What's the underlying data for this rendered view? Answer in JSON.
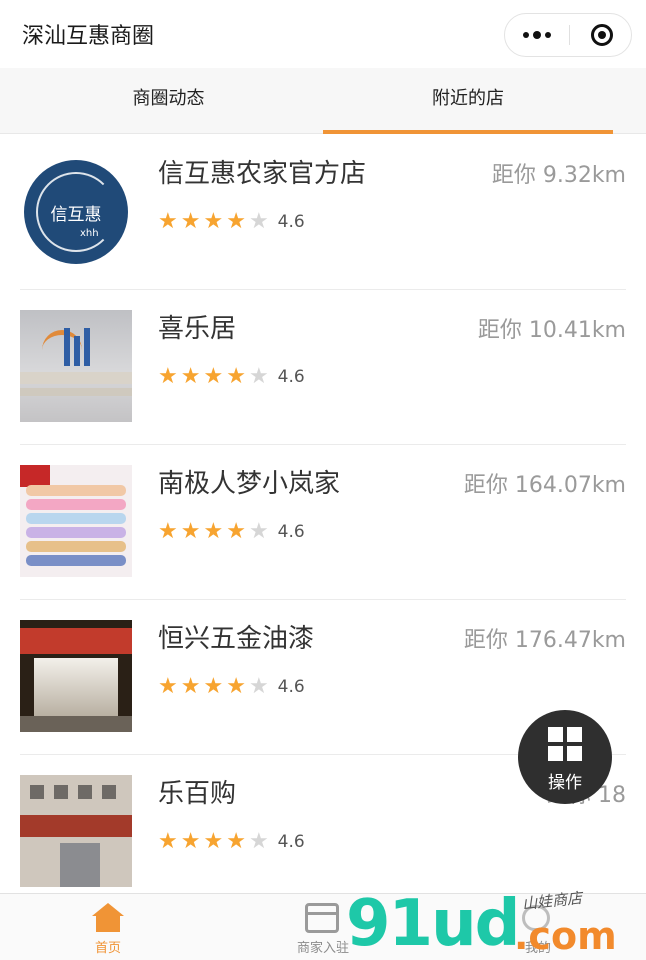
{
  "app": {
    "title": "深汕互惠商圈"
  },
  "tabs": [
    {
      "label": "商圈动态",
      "active": false
    },
    {
      "label": "附近的店",
      "active": true
    }
  ],
  "accent_color": "#f09436",
  "stores": [
    {
      "name": "信互惠农家官方店",
      "distance": "距你 9.32km",
      "stars": 4,
      "rating": "4.6",
      "logo_text": "信互惠",
      "logo_sub": "xhh"
    },
    {
      "name": "喜乐居",
      "distance": "距你 10.41km",
      "stars": 4,
      "rating": "4.6"
    },
    {
      "name": "南极人梦小岚家",
      "distance": "距你 164.07km",
      "stars": 4,
      "rating": "4.6"
    },
    {
      "name": "恒兴五金油漆",
      "distance": "距你 176.47km",
      "stars": 4,
      "rating": "4.6"
    },
    {
      "name": "乐百购",
      "distance": "距你 18",
      "stars": 4,
      "rating": "4.6"
    }
  ],
  "fab": {
    "label": "操作",
    "icon": "grid-icon"
  },
  "tabbar": [
    {
      "label": "首页",
      "icon": "home-icon",
      "active": true
    },
    {
      "label": "商家入驻",
      "icon": "shop-icon",
      "active": false
    },
    {
      "label": "我的",
      "icon": "user-icon",
      "active": false
    }
  ],
  "watermark": {
    "main": "91ud",
    "suffix": ".com",
    "sub": "山娃商店"
  }
}
